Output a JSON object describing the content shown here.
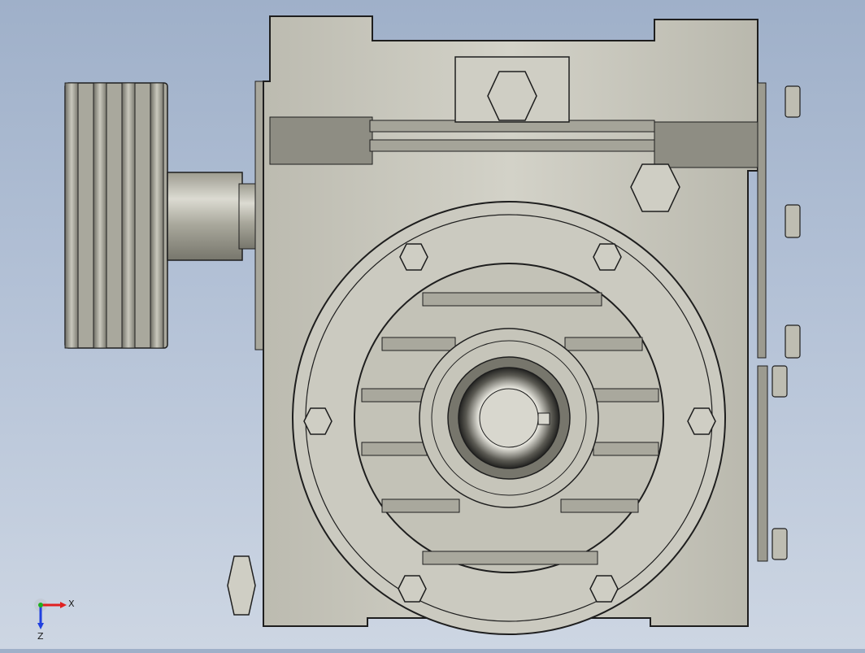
{
  "view": {
    "type": "cad-3d-viewport",
    "subject": "worm-gear-reducer",
    "background_top": "#9fb0c9",
    "background_bottom": "#cdd6e3",
    "body_color": "#c8c7bd",
    "edge_color": "#1e1e1e"
  },
  "triad": {
    "x_label": "X",
    "z_label": "Z",
    "x_color": "#e02020",
    "y_color": "#20b020",
    "z_color": "#2040e0"
  }
}
